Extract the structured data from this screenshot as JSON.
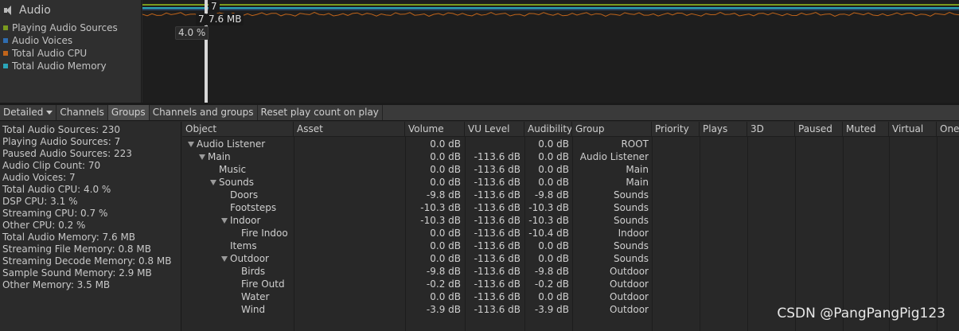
{
  "legend": {
    "title": "Audio",
    "items": [
      {
        "label": "Playing Audio Sources",
        "color": "#7a9a1e"
      },
      {
        "label": "Audio Voices",
        "color": "#2f6db0"
      },
      {
        "label": "Total Audio CPU",
        "color": "#c0641a"
      },
      {
        "label": "Total Audio Memory",
        "color": "#2aa5b8"
      }
    ]
  },
  "graph": {
    "tooltips": {
      "voices": "7",
      "sources": "7",
      "memory": "7.6 MB",
      "cpu": "4.0 %"
    },
    "line_colors": {
      "green": "#7a9a1e",
      "blue": "#2f6db0",
      "orange": "#c0641a",
      "cyan": "#2aa5b8"
    }
  },
  "toolbar": {
    "detailed": "Detailed",
    "channels": "Channels",
    "groups": "Groups",
    "channels_groups": "Channels and groups",
    "reset": "Reset play count on play"
  },
  "stats": [
    "Total Audio Sources: 230",
    "Playing Audio Sources: 7",
    "Paused Audio Sources: 223",
    "Audio Clip Count: 70",
    "Audio Voices: 7",
    "Total Audio CPU: 4.0 %",
    "DSP CPU: 3.1 %",
    "Streaming CPU: 0.7 %",
    "Other CPU: 0.2 %",
    "Total Audio Memory: 7.6 MB",
    "Streaming File Memory: 0.8 MB",
    "Streaming Decode Memory: 0.8 MB",
    "Sample Sound Memory: 2.9 MB",
    "Other Memory: 3.5 MB"
  ],
  "table": {
    "columns": [
      "Object",
      "Asset",
      "Volume",
      "VU Level",
      "Audibility",
      "Group",
      "Priority",
      "Plays",
      "3D",
      "Paused",
      "Muted",
      "Virtual",
      "One"
    ],
    "rows": [
      {
        "object": "Audio Listener",
        "depth": 0,
        "expand": true,
        "volume": "0.0 dB",
        "vu": "",
        "aud": "0.0 dB",
        "group": "ROOT"
      },
      {
        "object": "Main",
        "depth": 1,
        "expand": true,
        "volume": "0.0 dB",
        "vu": "-113.6 dB",
        "aud": "0.0 dB",
        "group": "Audio Listener"
      },
      {
        "object": "Music",
        "depth": 2,
        "expand": false,
        "volume": "0.0 dB",
        "vu": "-113.6 dB",
        "aud": "0.0 dB",
        "group": "Main"
      },
      {
        "object": "Sounds",
        "depth": 2,
        "expand": true,
        "volume": "0.0 dB",
        "vu": "-113.6 dB",
        "aud": "0.0 dB",
        "group": "Main"
      },
      {
        "object": "Doors",
        "depth": 3,
        "expand": false,
        "volume": "-9.8 dB",
        "vu": "-113.6 dB",
        "aud": "-9.8 dB",
        "group": "Sounds"
      },
      {
        "object": "Footsteps",
        "depth": 3,
        "expand": false,
        "volume": "-10.3 dB",
        "vu": "-113.6 dB",
        "aud": "-10.3 dB",
        "group": "Sounds"
      },
      {
        "object": "Indoor",
        "depth": 3,
        "expand": true,
        "volume": "-10.3 dB",
        "vu": "-113.6 dB",
        "aud": "-10.3 dB",
        "group": "Sounds"
      },
      {
        "object": "Fire Indoo",
        "depth": 4,
        "expand": false,
        "volume": "0.0 dB",
        "vu": "-113.6 dB",
        "aud": "-10.4 dB",
        "group": "Indoor"
      },
      {
        "object": "Items",
        "depth": 3,
        "expand": false,
        "volume": "0.0 dB",
        "vu": "-113.6 dB",
        "aud": "0.0 dB",
        "group": "Sounds"
      },
      {
        "object": "Outdoor",
        "depth": 3,
        "expand": true,
        "volume": "0.0 dB",
        "vu": "-113.6 dB",
        "aud": "0.0 dB",
        "group": "Sounds"
      },
      {
        "object": "Birds",
        "depth": 4,
        "expand": false,
        "volume": "-9.8 dB",
        "vu": "-113.6 dB",
        "aud": "-9.8 dB",
        "group": "Outdoor"
      },
      {
        "object": "Fire Outd",
        "depth": 4,
        "expand": false,
        "volume": "-0.2 dB",
        "vu": "-113.6 dB",
        "aud": "-0.2 dB",
        "group": "Outdoor"
      },
      {
        "object": "Water",
        "depth": 4,
        "expand": false,
        "volume": "0.0 dB",
        "vu": "-113.6 dB",
        "aud": "0.0 dB",
        "group": "Outdoor"
      },
      {
        "object": "Wind",
        "depth": 4,
        "expand": false,
        "volume": "-3.9 dB",
        "vu": "-113.6 dB",
        "aud": "-3.9 dB",
        "group": "Outdoor"
      }
    ]
  },
  "watermark": "CSDN @PangPangPig123"
}
